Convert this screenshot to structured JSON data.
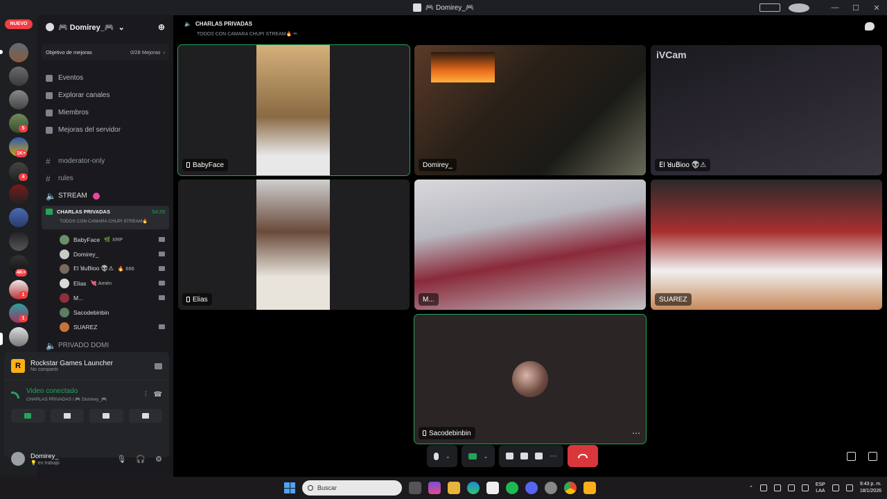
{
  "window": {
    "title": "🎮 Domirey_🎮"
  },
  "servers": {
    "new_label": "NUEVO",
    "badges": [
      "5",
      "1K+",
      "4",
      "4K+",
      "1",
      "1"
    ]
  },
  "guild": {
    "name": "🎮 Domirey_🎮",
    "boost_goal": "Objetivo de mejoras",
    "boost_count": "0/28 Mejoras"
  },
  "menu": {
    "events": "Eventos",
    "explore": "Explorar canales",
    "members": "Miembros",
    "boosts": "Mejoras del servidor"
  },
  "channels": {
    "moderator": "moderator-only",
    "rules": "rules",
    "stream": "STREAM",
    "private_domi": "PRIVADO DOMI"
  },
  "voice_channel": {
    "name": "CHARLAS PRIVADAS",
    "timer": "54:29",
    "topic": "TODOS CON CAMARA CHUPI STREAM🔥"
  },
  "voice_members": [
    {
      "name": "BabyFace",
      "tag": "🌿 XRP",
      "color": "#6b8f6b"
    },
    {
      "name": "Domirey_",
      "tag": "",
      "color": "#c9c9c9"
    },
    {
      "name": "ꓰl ꓤuꓐᎥoo 👽⚠",
      "tag": "🔥 666",
      "color": "#7a6a5a"
    },
    {
      "name": "Elias",
      "tag": "💘 Amén",
      "color": "#d9d9d9"
    },
    {
      "name": "M...",
      "tag": "",
      "color": "#8e2f3a"
    },
    {
      "name": "Sacodebinbin",
      "tag": "",
      "color": "#5a7d64"
    },
    {
      "name": "SUAREZ",
      "tag": "",
      "color": "#c7743a"
    }
  ],
  "activity": {
    "title": "Rockstar Games Launcher",
    "subtitle": "No compartir"
  },
  "connection": {
    "title": "Video conectado",
    "subtitle": "CHARLAS PRIVADAS / 🎮 Domirey_🎮"
  },
  "user": {
    "name": "Domirey_",
    "status": "💡 en trabajo"
  },
  "header": {
    "channel": "CHARLAS PRIVADAS",
    "topic": "TODOS CON CAMARA CHUPI STREAM🔥 ✏"
  },
  "tiles": {
    "babyface": "BabyFace",
    "domirey": "Domirey_",
    "rubioo": "ꓰl ꓤuꓐᎥoo 👽⚠",
    "ivcam": "iVCam",
    "elias": "Elias",
    "m": "M...",
    "suarez": "SUAREZ",
    "sacode": "Sacodebinbin",
    "more": "⋯"
  },
  "taskbar": {
    "search_placeholder": "Buscar",
    "lang_top": "ESP",
    "lang_bottom": "LAA",
    "time": "9:43 p. m.",
    "date": "18/1/2026"
  },
  "colors": {
    "speaking": "#23a55a",
    "hangup": "#da373c",
    "badge": "#f23f43"
  }
}
